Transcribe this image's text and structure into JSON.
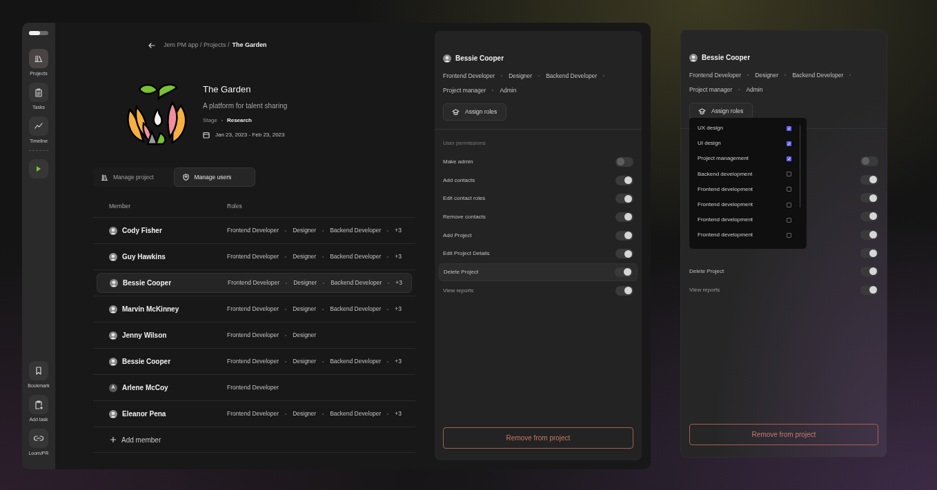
{
  "sidebar": {
    "items": [
      {
        "kind": "projects",
        "label": "Projects",
        "selected": true
      },
      {
        "kind": "tasks",
        "label": "Tasks",
        "selected": false
      },
      {
        "kind": "timeline",
        "label": "Timeline",
        "selected": false
      },
      {
        "kind": "play",
        "selected": false
      }
    ],
    "bottom_items": [
      {
        "kind": "bookmark",
        "label": "Bookmark"
      },
      {
        "kind": "add_task",
        "label": "Add task"
      },
      {
        "kind": "loom",
        "label": "Loom/PR"
      }
    ]
  },
  "breadcrumb": {
    "path": "Jem PM app / Projects /",
    "current": "The Garden"
  },
  "project": {
    "title": "The Garden",
    "subtitle": "A platform for talent sharing",
    "stage_label": "Stage",
    "stage": "Research",
    "dates": "Jan 23, 2023 - Feb 23, 2023"
  },
  "tabs": [
    {
      "label": "Manage project",
      "kind": "project",
      "selected": false
    },
    {
      "label": "Manage users",
      "kind": "users",
      "selected": true
    }
  ],
  "table": {
    "columns": [
      "Member",
      "Roles"
    ],
    "rows": [
      {
        "name": "Cody Fisher",
        "avatar": {
          "kind": "photo"
        },
        "roles": [
          "Frontend Developer",
          "Designer",
          "Backend Developer"
        ],
        "extra": "+3",
        "selected": false
      },
      {
        "name": "Guy Hawkins",
        "avatar": {
          "kind": "photo"
        },
        "roles": [
          "Frontend Developer",
          "Designer",
          "Backend Developer"
        ],
        "extra": "+3",
        "selected": false
      },
      {
        "name": "Bessie Cooper",
        "avatar": {
          "kind": "photo"
        },
        "roles": [
          "Frontend Developer",
          "Designer",
          "Backend Developer"
        ],
        "extra": "+3",
        "selected": true
      },
      {
        "name": "Marvin McKinney",
        "avatar": {
          "kind": "photo"
        },
        "roles": [
          "Frontend Developer",
          "Designer",
          "Backend Developer"
        ],
        "extra": "+3",
        "selected": false
      },
      {
        "name": "Jenny Wilson",
        "avatar": {
          "kind": "photo"
        },
        "roles": [
          "Frontend Developer",
          "Designer"
        ],
        "selected": false
      },
      {
        "name": "Bessie Cooper",
        "avatar": {
          "kind": "photo"
        },
        "roles": [
          "Frontend Developer",
          "Designer",
          "Backend Developer"
        ],
        "extra": "+3",
        "selected": false
      },
      {
        "name": "Arlene McCoy",
        "avatar": {
          "kind": "initial",
          "initial": "A"
        },
        "roles": [
          "Frontend Developer"
        ],
        "selected": false
      },
      {
        "name": "Eleanor Pena",
        "avatar": {
          "kind": "photo"
        },
        "roles": [
          "Frontend Developer",
          "Designer",
          "Backend Developer"
        ],
        "extra": "+3",
        "selected": false
      }
    ],
    "add_label": "Add member"
  },
  "panels": [
    {
      "name": "Bessie Cooper",
      "roles": [
        "Frontend Developer",
        "Designer",
        "Backend Developer",
        "Project manager",
        "Admin"
      ],
      "assign_label": "Assign roles",
      "permissions_title": "User permissions",
      "permissions": [
        {
          "label": "Make admin",
          "on": false,
          "highlighted": false
        },
        {
          "label": "Add contacts",
          "on": true,
          "highlighted": false
        },
        {
          "label": "Edit contact roles",
          "on": true,
          "highlighted": false
        },
        {
          "label": "Remove contacts",
          "on": true,
          "highlighted": false
        },
        {
          "label": "Add Project",
          "on": true,
          "highlighted": false
        },
        {
          "label": "Edit Project Details",
          "on": true,
          "highlighted": false
        },
        {
          "label": "Delete Project",
          "on": true,
          "highlighted": true
        },
        {
          "label": "View reports",
          "on": true,
          "highlighted": false
        }
      ],
      "remove_label": "Remove from project"
    },
    {
      "name": "Bessie Cooper",
      "roles": [
        "Frontend Developer",
        "Designer",
        "Backend Developer",
        "Project manager",
        "Admin"
      ],
      "assign_label": "Assign roles",
      "permissions": [
        {
          "on": false
        },
        {
          "on": true
        },
        {
          "on": true
        },
        {
          "on": true
        },
        {
          "on": true
        },
        {
          "on": true
        },
        {
          "label": "Delete Project",
          "on": true
        },
        {
          "label": "View reports",
          "on": true
        }
      ],
      "dropdown": {
        "items": [
          {
            "label": "UX design",
            "checked": true
          },
          {
            "label": "UI design",
            "checked": true
          },
          {
            "label": "Project management",
            "checked": true
          },
          {
            "label": "Backend development",
            "checked": false
          },
          {
            "label": "Frontend development",
            "checked": false
          },
          {
            "label": "Frontend development",
            "checked": false
          },
          {
            "label": "Frontend development",
            "checked": false
          },
          {
            "label": "Frontend development",
            "checked": false
          }
        ]
      },
      "remove_label": "Remove from project"
    }
  ]
}
